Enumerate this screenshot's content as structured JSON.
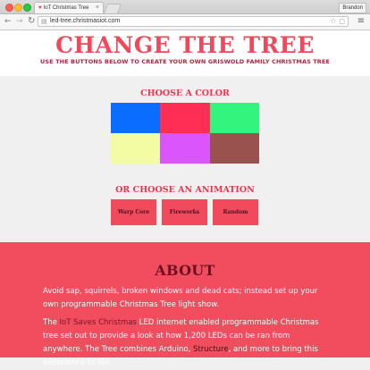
{
  "browser": {
    "tab_title": "IoT Christmas Tree",
    "profile_name": "Brandon",
    "url": "led-tree.christmasiot.com"
  },
  "header": {
    "title": "CHANGE THE TREE",
    "subtitle": "USE THE BUTTONS BELOW TO CREATE YOUR OWN GRISWOLD FAMILY CHRISTMAS TREE"
  },
  "colors": {
    "heading": "CHOOSE A COLOR",
    "swatches": [
      "#0a6dff",
      "#ff2e55",
      "#33f57d",
      "#f4fca3",
      "#db55fd",
      "#99524e"
    ]
  },
  "animations": {
    "heading": "OR CHOOSE AN ANIMATION",
    "buttons": [
      "Warp Core",
      "Fireworks",
      "Random"
    ]
  },
  "about": {
    "title": "ABOUT",
    "p1": "Avoid sap, squirrels, broken windows and dead cats; instead set up your own programmable Christmas Tree light show.",
    "p2_pre": "The ",
    "p2_link1": "IoT Saves Christmas",
    "p2_mid1": " LED internet enabled programmable Christmas tree set out to provide a look at how 1,200 LEDs can be ran from anywhere. The Tree combines Arduino, ",
    "p2_link2": "Structure",
    "p2_post": ", and more to bring this experience to life."
  }
}
